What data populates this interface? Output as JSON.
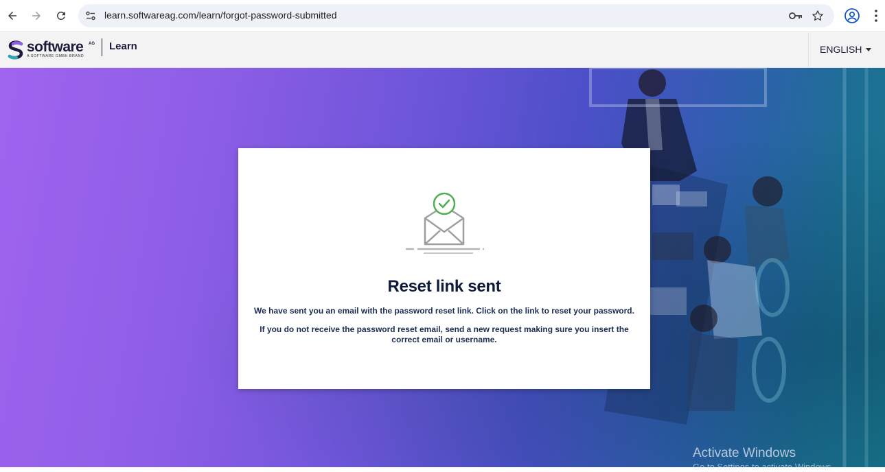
{
  "browser": {
    "url": "learn.softwareag.com/learn/forgot-password-submitted",
    "icons": [
      "back-arrow-icon",
      "forward-arrow-icon",
      "reload-icon",
      "site-settings-icon",
      "password-key-icon",
      "bookmark-star-icon",
      "profile-icon",
      "kebab-menu-icon"
    ]
  },
  "header": {
    "brand_word": "software",
    "brand_sup": "AG",
    "brand_tagline": "A SOFTWARE GMBH BRAND",
    "product": "Learn",
    "language": "ENGLISH"
  },
  "card": {
    "title": "Reset link sent",
    "message_primary": "We have sent you an email with the password reset link. Click on the link to reset your password.",
    "message_secondary": "If you do not receive the password reset email, send a new request making sure you insert the correct email or username."
  },
  "os_watermark": {
    "title": "Activate Windows",
    "subtitle": "Go to Settings to activate Windows."
  },
  "colors": {
    "accent_check": "#4caf50",
    "title_text": "#0e1a3a",
    "hero_start": "#a064ef",
    "hero_end": "#197a8e"
  }
}
